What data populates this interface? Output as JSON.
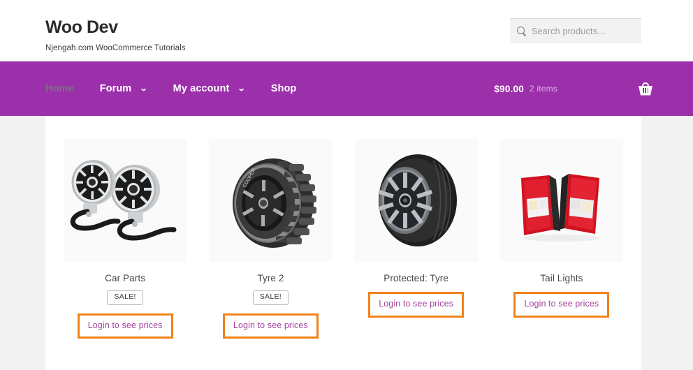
{
  "header": {
    "brand_title": "Woo Dev",
    "brand_tagline": "Njengah.com WooCommerce Tutorials",
    "search": {
      "placeholder": "Search products…",
      "value": "",
      "icon": "search-icon"
    }
  },
  "nav": {
    "accent_color": "#9c2faa",
    "items": [
      {
        "label": "Home",
        "active": true,
        "has_dropdown": false
      },
      {
        "label": "Forum",
        "active": false,
        "has_dropdown": true,
        "caret": "⌄"
      },
      {
        "label": "My account",
        "active": false,
        "has_dropdown": true,
        "caret": "⌄"
      },
      {
        "label": "Shop",
        "active": false,
        "has_dropdown": false
      }
    ],
    "cart": {
      "amount": "$90.00",
      "items_label": "2 items",
      "icon": "shopping-basket-icon"
    }
  },
  "products": [
    {
      "title": "Car Parts",
      "image": "car-speakers-image",
      "sale_badge": "SALE!",
      "has_sale_badge": true,
      "price_button": "Login to see prices"
    },
    {
      "title": "Tyre 2",
      "image": "offroad-tyre-image",
      "sale_badge": "SALE!",
      "has_sale_badge": true,
      "price_button": "Login to see prices"
    },
    {
      "title": "Protected: Tyre",
      "image": "alloy-wheel-tyre-image",
      "sale_badge": "",
      "has_sale_badge": false,
      "price_button": "Login to see prices"
    },
    {
      "title": "Tail Lights",
      "image": "tail-lights-image",
      "sale_badge": "",
      "has_sale_badge": false,
      "price_button": "Login to see prices"
    }
  ],
  "colors": {
    "nav_purple": "#9c2faa",
    "button_border_orange": "#f08218",
    "button_text_purple": "#a3439b",
    "page_background": "#f2f2f2"
  }
}
